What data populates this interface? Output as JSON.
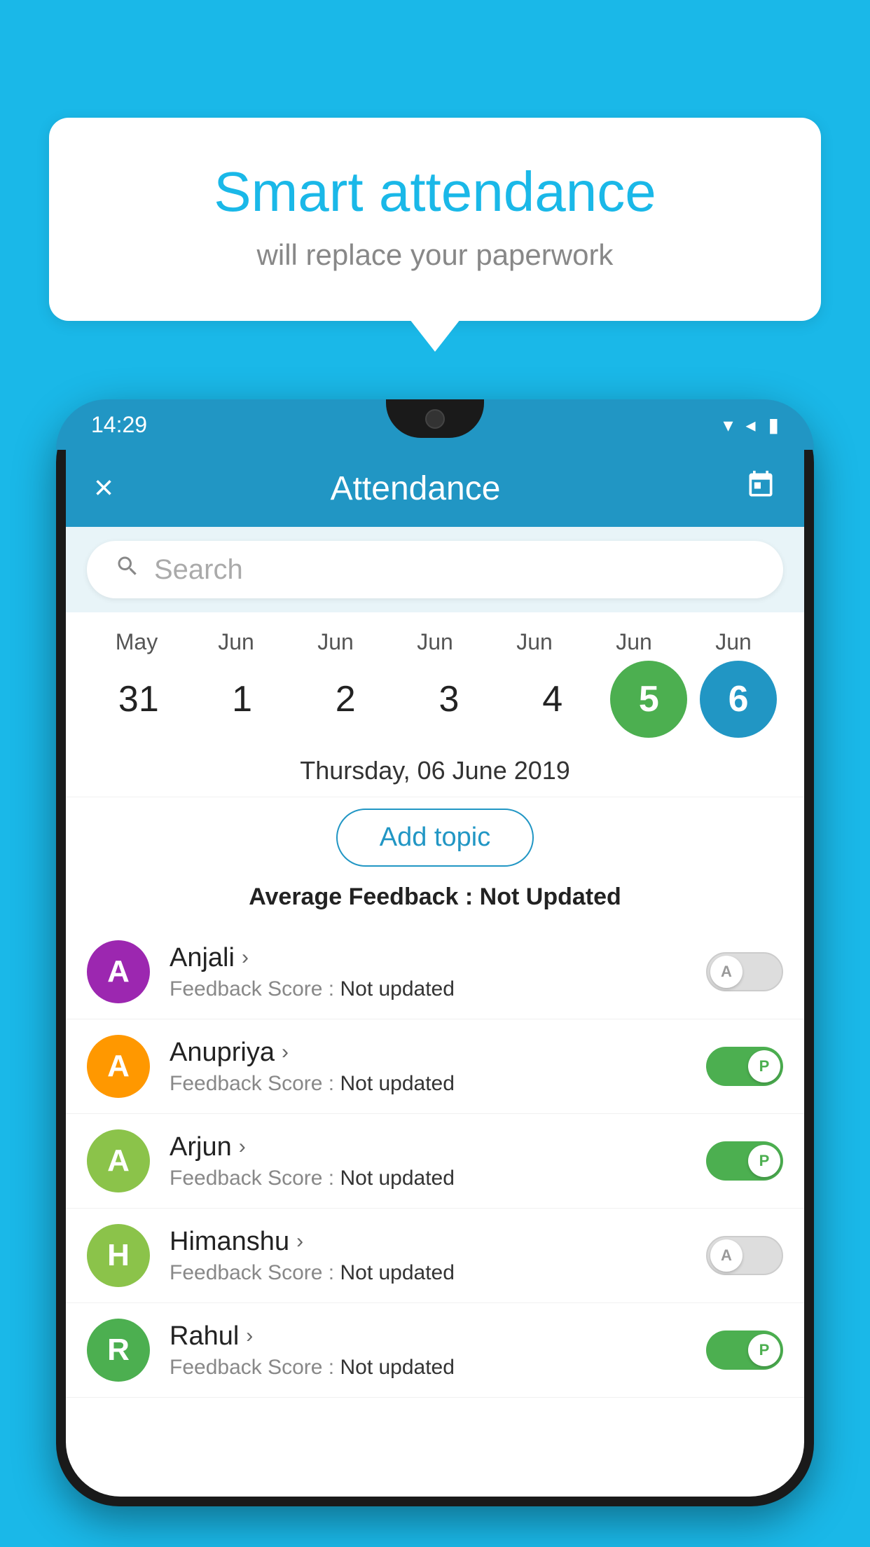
{
  "background_color": "#1ab8e8",
  "bubble": {
    "title": "Smart attendance",
    "subtitle": "will replace your paperwork"
  },
  "status_bar": {
    "time": "14:29",
    "wifi_icon": "▼",
    "signal_icon": "▲",
    "battery_icon": "▮"
  },
  "app_header": {
    "close_icon": "×",
    "title": "Attendance",
    "calendar_icon": "📅"
  },
  "search": {
    "placeholder": "Search"
  },
  "calendar": {
    "days": [
      {
        "month": "May",
        "date": "31",
        "state": "normal"
      },
      {
        "month": "Jun",
        "date": "1",
        "state": "normal"
      },
      {
        "month": "Jun",
        "date": "2",
        "state": "normal"
      },
      {
        "month": "Jun",
        "date": "3",
        "state": "normal"
      },
      {
        "month": "Jun",
        "date": "4",
        "state": "normal"
      },
      {
        "month": "Jun",
        "date": "5",
        "state": "today"
      },
      {
        "month": "Jun",
        "date": "6",
        "state": "selected"
      }
    ]
  },
  "selected_date": "Thursday, 06 June 2019",
  "add_topic_label": "Add topic",
  "feedback_summary": {
    "label": "Average Feedback : ",
    "value": "Not Updated"
  },
  "students": [
    {
      "name": "Anjali",
      "avatar_letter": "A",
      "avatar_color": "#9c27b0",
      "feedback_label": "Feedback Score : ",
      "feedback_value": "Not updated",
      "toggle_state": "off",
      "toggle_letter": "A"
    },
    {
      "name": "Anupriya",
      "avatar_letter": "A",
      "avatar_color": "#ff9800",
      "feedback_label": "Feedback Score : ",
      "feedback_value": "Not updated",
      "toggle_state": "on",
      "toggle_letter": "P"
    },
    {
      "name": "Arjun",
      "avatar_letter": "A",
      "avatar_color": "#8bc34a",
      "feedback_label": "Feedback Score : ",
      "feedback_value": "Not updated",
      "toggle_state": "on",
      "toggle_letter": "P"
    },
    {
      "name": "Himanshu",
      "avatar_letter": "H",
      "avatar_color": "#8bc34a",
      "feedback_label": "Feedback Score : ",
      "feedback_value": "Not updated",
      "toggle_state": "off",
      "toggle_letter": "A"
    },
    {
      "name": "Rahul",
      "avatar_letter": "R",
      "avatar_color": "#4caf50",
      "feedback_label": "Feedback Score : ",
      "feedback_value": "Not updated",
      "toggle_state": "on",
      "toggle_letter": "P"
    }
  ]
}
